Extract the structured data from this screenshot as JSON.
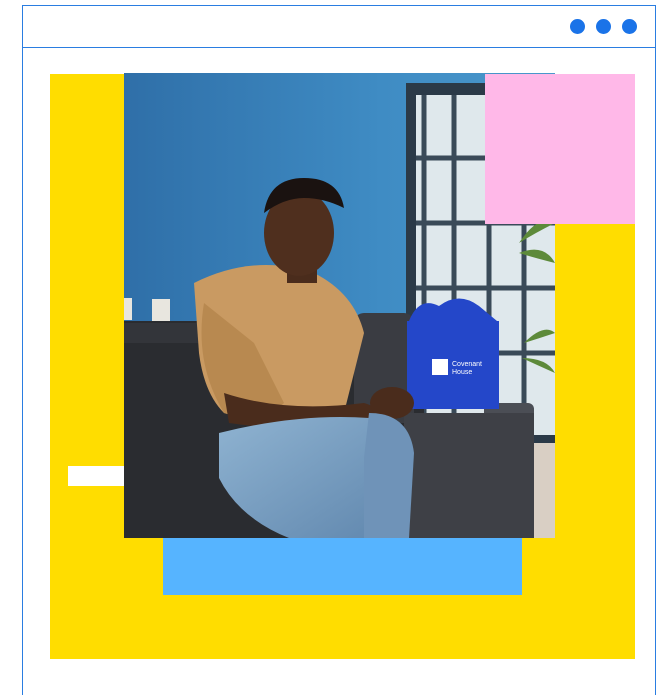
{
  "window": {
    "controls": [
      "dot-icon",
      "dot-icon",
      "dot-icon"
    ]
  },
  "photo": {
    "bag_text_line1": "Covenant",
    "bag_text_line2": "House"
  },
  "colors": {
    "frame_border": "#2a7de1",
    "dots": "#1a73e8",
    "yellow": "#ffdd00",
    "light_blue": "#56b4ff",
    "pink": "#ffb8e8",
    "wall": "#3d88c0",
    "bag": "#2447c9"
  }
}
